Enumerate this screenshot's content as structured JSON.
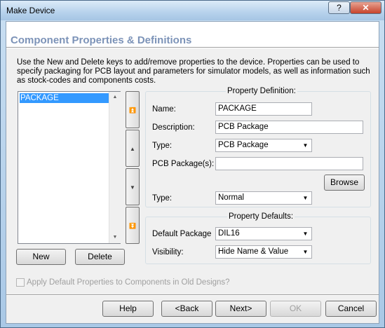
{
  "window": {
    "title": "Make Device",
    "help_glyph": "?",
    "close_glyph": "✕"
  },
  "header": {
    "heading": "Component Properties & Definitions"
  },
  "description": "Use the New and Delete keys to add/remove properties to the device. Properties can be used to specify packaging for PCB layout and parameters for simulator models, as well as information such as stock-codes and components costs.",
  "property_list": {
    "items": [
      "PACKAGE"
    ],
    "selected": "PACKAGE"
  },
  "list_buttons": {
    "new": "New",
    "delete": "Delete"
  },
  "property_definition": {
    "title": "Property Definition:",
    "name_label": "Name:",
    "name_value": "PACKAGE",
    "description_label": "Description:",
    "description_value": "PCB Package",
    "type_label": "Type:",
    "type_value": "PCB Package",
    "pcb_packages_label": "PCB Package(s):",
    "pcb_packages_value": "",
    "browse": "Browse",
    "type2_label": "Type:",
    "type2_value": "Normal"
  },
  "property_defaults": {
    "title": "Property Defaults:",
    "default_package_label": "Default Package",
    "default_package_value": "DIL16",
    "visibility_label": "Visibility:",
    "visibility_value": "Hide Name & Value"
  },
  "apply_checkbox": {
    "label": "Apply Default Properties to Components in Old Designs?",
    "checked": false,
    "enabled": false
  },
  "footer_buttons": {
    "help": "Help",
    "back": "<Back",
    "next": "Next>",
    "ok": "OK",
    "cancel": "Cancel"
  },
  "icons": {
    "move_top": "double-up-arrow-icon",
    "move_up": "up-arrow-icon",
    "move_down": "down-arrow-icon",
    "move_bottom": "double-down-arrow-icon"
  }
}
